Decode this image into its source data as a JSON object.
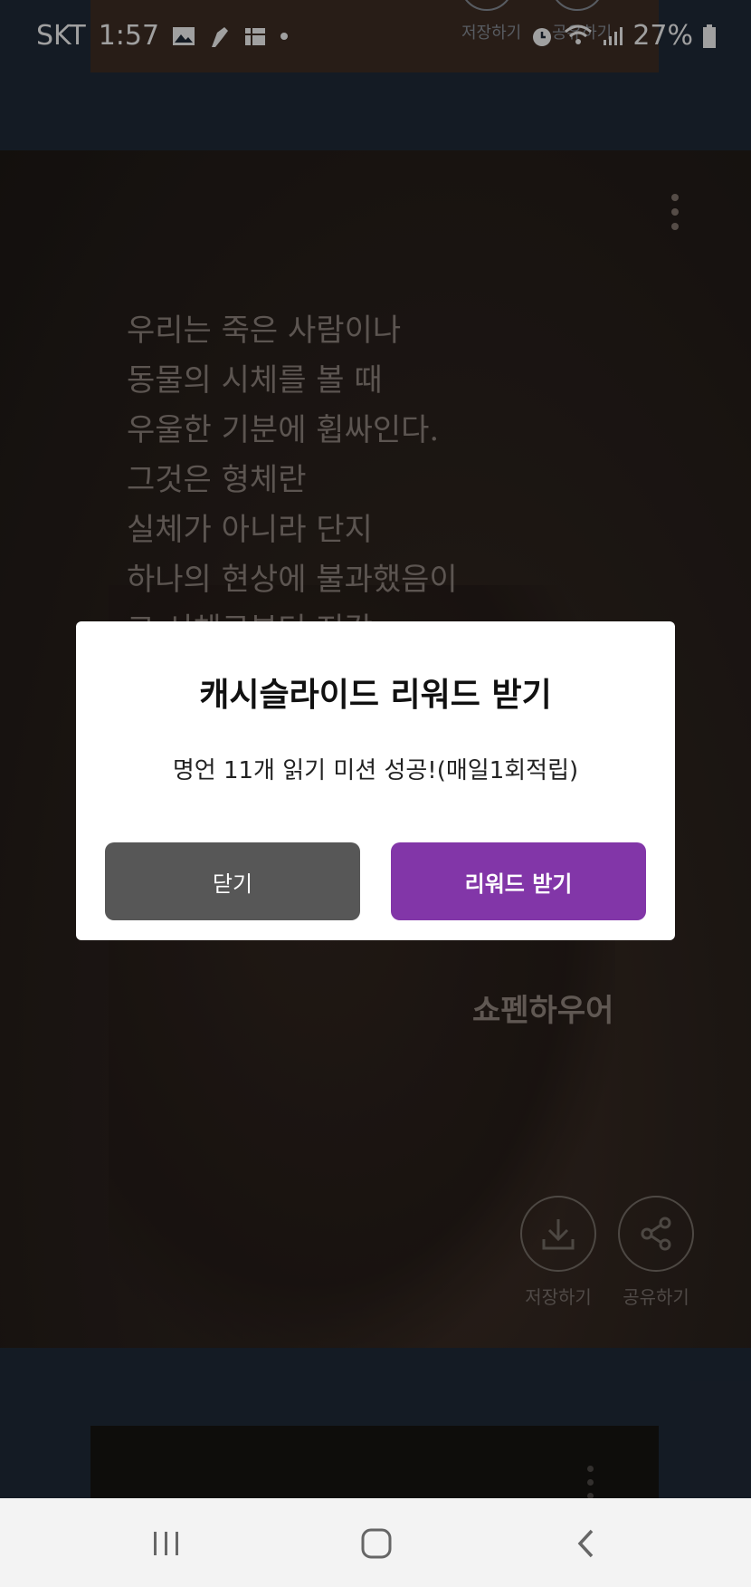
{
  "status_bar": {
    "carrier": "SKT",
    "time": "1:57",
    "battery": "27%",
    "icons": [
      "image-icon",
      "notification-icon",
      "app-icon",
      "dot-icon",
      "alarm-icon",
      "wifi-icon",
      "signal-icon",
      "battery-icon"
    ]
  },
  "top_card": {
    "save_label": "저장하기",
    "share_label": "공유하기"
  },
  "quote_card": {
    "lines": [
      "우리는 죽은 사람이나",
      "동물의 시체를 볼 때",
      "우울한 기분에 휩싸인다.",
      "그것은 형체란",
      "실체가 아니라 단지",
      "하나의 현상에 불과했음이",
      "그 시체로부터 지각"
    ],
    "author": "쇼펜하우어",
    "save_label": "저장하기",
    "share_label": "공유하기"
  },
  "dialog": {
    "title": "캐시슬라이드 리워드 받기",
    "message": "명언 11개 읽기 미션 성공!(매일1회적립)",
    "close_label": "닫기",
    "reward_label": "리워드 받기"
  },
  "colors": {
    "reward_button": "#8236a8",
    "close_button": "#575757",
    "dialog_bg": "#ffffff"
  }
}
